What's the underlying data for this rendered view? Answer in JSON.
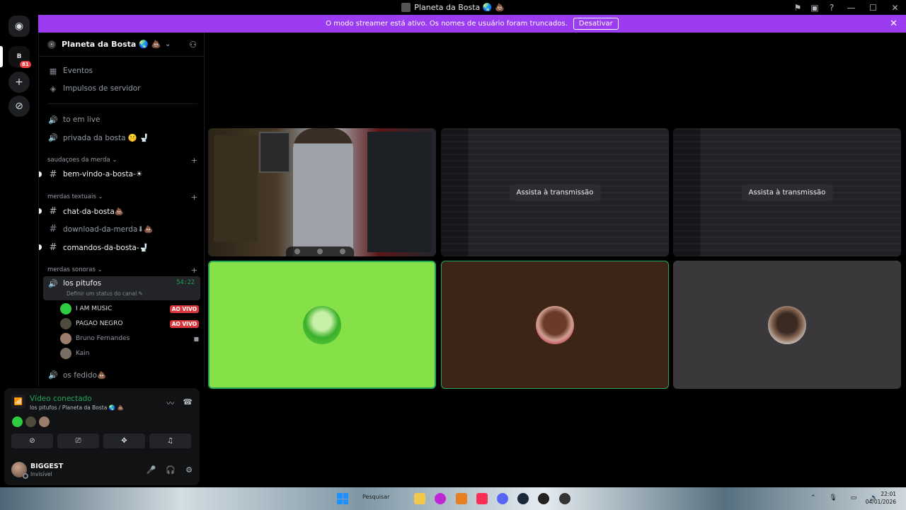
{
  "window": {
    "title": "Planeta da Bosta 🌏 💩",
    "controls": {
      "flag": "⚑",
      "cast": "▣",
      "help": "?",
      "minimize": "—",
      "maximize": "☐",
      "close": "✕"
    }
  },
  "streamer_bar": {
    "message": "O modo streamer está ativo. Os nomes de usuário foram truncados.",
    "button": "Desativar",
    "close": "✕"
  },
  "guild_rail": {
    "home_glyph": "◉",
    "server_initial": "B",
    "server_badge": "81",
    "add_glyph": "+",
    "discover_glyph": "⊘"
  },
  "server": {
    "name": "Planeta da Bosta 🌏 💩",
    "chevron": "⌄",
    "invite_glyph": "⚇",
    "shield_glyph": "⦿"
  },
  "sidebar": {
    "events": {
      "icon": "▦",
      "label": "Eventos"
    },
    "boosts": {
      "icon": "◈",
      "label": "Impulsos de servidor"
    },
    "top_channels": [
      {
        "icon": "🔊",
        "label": "to em live"
      },
      {
        "icon": "🔊",
        "label": "privada da bosta 🤫 🚽"
      }
    ],
    "categories": [
      {
        "name": "saudaçoes da merda ⌄",
        "plus": "+",
        "channels": [
          {
            "icon": "#",
            "label": "bem-vindo-a-bosta-☀"
          }
        ]
      },
      {
        "name": "merdas textuais ⌄",
        "plus": "+",
        "channels": [
          {
            "icon": "#",
            "label": "chat-da-bosta💩"
          },
          {
            "icon": "#",
            "label": "download-da-merda⬇💩"
          },
          {
            "icon": "#",
            "label": "comandos-da-bosta-🚽"
          }
        ]
      },
      {
        "name": "merdas sonoras ⌄",
        "plus": "+"
      }
    ],
    "voice_channel": {
      "icon": "🔊",
      "label": "los pitufos",
      "timer": "54:22",
      "status": "Definir um status do canal ✎"
    },
    "voice_users": [
      {
        "name": "I AM MUSIC",
        "badge": "AO VIVO",
        "color": "#2ecc40"
      },
      {
        "name": "PAGAO NEGRO",
        "badge": "AO VIVO",
        "color": "#4e4a3c"
      },
      {
        "name": "Bruno Fernandes",
        "cam": "■",
        "color": "#9a7d6b"
      },
      {
        "name": "Kain",
        "color": "#7a6d62"
      }
    ],
    "other_voice": {
      "icon": "🔊",
      "label": "os fedido💩"
    }
  },
  "voice_panel": {
    "signal": "📶",
    "title": "Vídeo conectado",
    "subtitle": "los pitufos / Planeta da Bosta 🌏 💩",
    "noise_icon": "〰",
    "disconnect_icon": "☎",
    "avatars": [
      "#2ecc40",
      "#4e4a3c",
      "#9a7d6b"
    ],
    "buttons": [
      {
        "name": "camera-off-button",
        "glyph": "⊘"
      },
      {
        "name": "screen-share-button",
        "glyph": "⎚"
      },
      {
        "name": "activities-button",
        "glyph": "✥"
      },
      {
        "name": "soundboard-button",
        "glyph": "♫"
      }
    ]
  },
  "user": {
    "name": "BIGGEST",
    "status": "Invisível",
    "mic": "🎤",
    "headset": "🎧",
    "settings": "⚙"
  },
  "stage": {
    "watch_label_1": "Assista à transmissão",
    "watch_label_2": "Assista à transmissão"
  },
  "taskbar": {
    "search": "Pesquisar",
    "time": "22:01",
    "date": "04/01/2026",
    "tray": "⌃ 🎙 ▭ 🔊"
  }
}
